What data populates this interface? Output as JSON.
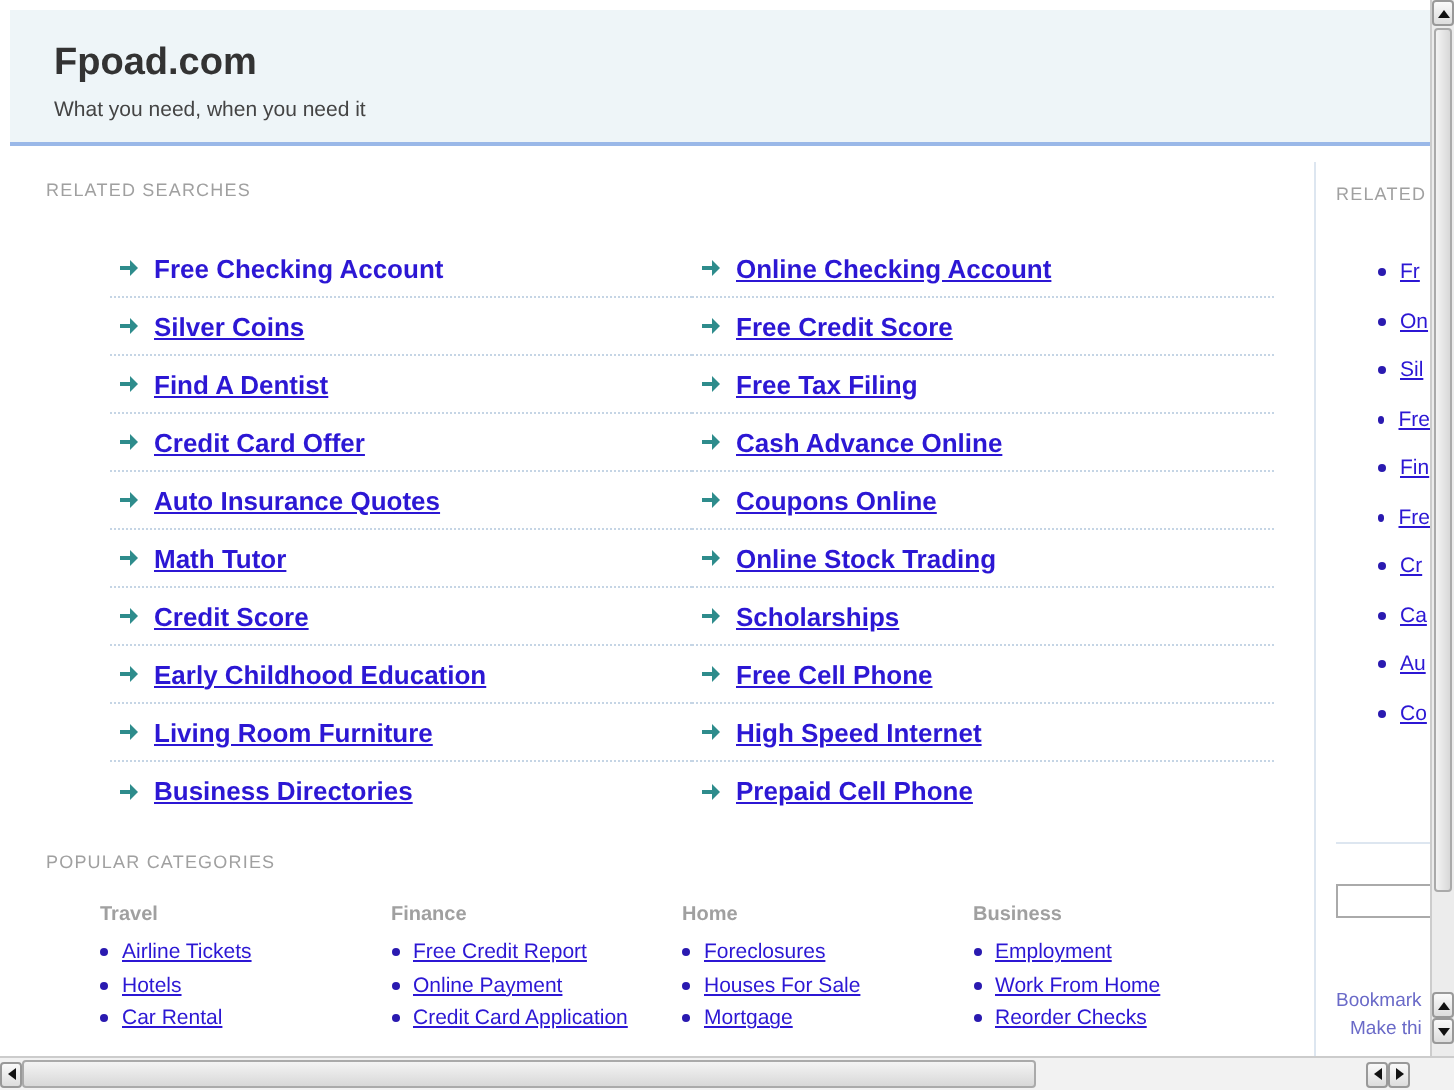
{
  "header": {
    "title": "Fpoad.com",
    "tagline": "What you need, when you need it"
  },
  "related_searches": {
    "heading": "RELATED SEARCHES",
    "links": [
      {
        "label": "Free Checking Account",
        "hovered": true
      },
      {
        "label": "Online Checking Account",
        "hovered": false
      },
      {
        "label": "Silver Coins",
        "hovered": false
      },
      {
        "label": "Free Credit Score",
        "hovered": false
      },
      {
        "label": "Find A Dentist",
        "hovered": false
      },
      {
        "label": "Free Tax Filing",
        "hovered": false
      },
      {
        "label": "Credit Card Offer",
        "hovered": false
      },
      {
        "label": "Cash Advance Online",
        "hovered": false
      },
      {
        "label": "Auto Insurance Quotes",
        "hovered": false
      },
      {
        "label": "Coupons Online",
        "hovered": false
      },
      {
        "label": "Math Tutor",
        "hovered": false
      },
      {
        "label": "Online Stock Trading",
        "hovered": false
      },
      {
        "label": "Credit Score",
        "hovered": false
      },
      {
        "label": "Scholarships",
        "hovered": false
      },
      {
        "label": "Early Childhood Education",
        "hovered": false
      },
      {
        "label": "Free Cell Phone",
        "hovered": false
      },
      {
        "label": "Living Room Furniture",
        "hovered": false
      },
      {
        "label": "High Speed Internet",
        "hovered": false
      },
      {
        "label": "Business Directories",
        "hovered": false
      },
      {
        "label": "Prepaid Cell Phone",
        "hovered": false
      }
    ]
  },
  "popular_categories": {
    "heading": "POPULAR CATEGORIES",
    "columns": [
      {
        "title": "Travel",
        "links": [
          "Airline Tickets",
          "Hotels",
          "Car Rental"
        ]
      },
      {
        "title": "Finance",
        "links": [
          "Free Credit Report",
          "Online Payment",
          "Credit Card Application"
        ]
      },
      {
        "title": "Home",
        "links": [
          "Foreclosures",
          "Houses For Sale",
          "Mortgage"
        ]
      },
      {
        "title": "Business",
        "links": [
          "Employment",
          "Work From Home",
          "Reorder Checks"
        ]
      }
    ]
  },
  "sidebar": {
    "heading": "RELATED",
    "links": [
      "Fr",
      "On",
      "Sil",
      "Fre",
      "Fin",
      "Fre",
      "Cr",
      "Ca",
      "Au",
      "Co"
    ],
    "bookmark": "Bookmark",
    "make": "Make thi"
  }
}
